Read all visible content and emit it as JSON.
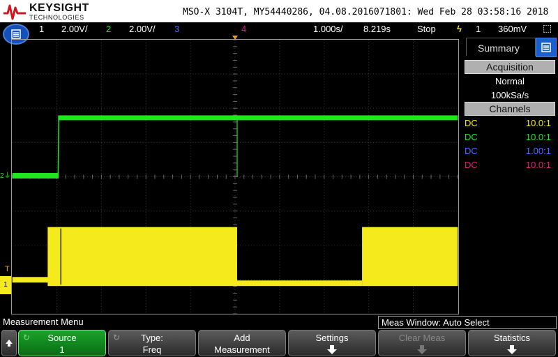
{
  "header": {
    "brand": "KEYSIGHT",
    "brand_sub": "TECHNOLOGIES",
    "model_line": "MSO-X 3104T, MY54440286, 04.08.2016071801: Wed Feb 28 03:58:16 2018"
  },
  "status": {
    "ch1_num": "1",
    "ch1_scale": "2.00V/",
    "ch2_num": "2",
    "ch2_scale": "2.00V/",
    "ch3_num": "3",
    "ch4_num": "4",
    "timebase": "1.000s/",
    "delay": "8.219s",
    "run_state": "Stop",
    "trigger_source": "1",
    "trigger_level": "360mV"
  },
  "side_panel": {
    "tab_label": "Summary",
    "acquisition_header": "Acquisition",
    "acq_mode": "Normal",
    "sample_rate": "100kSa/s",
    "channels_header": "Channels",
    "channels": [
      {
        "coupling": "DC",
        "probe": "10.0:1",
        "color": "#f4ea1c"
      },
      {
        "coupling": "DC",
        "probe": "10.0:1",
        "color": "#20e620"
      },
      {
        "coupling": "DC",
        "probe": "1.00:1",
        "color": "#4a6cff"
      },
      {
        "coupling": "DC",
        "probe": "10.0:1",
        "color": "#e0207a"
      }
    ]
  },
  "waveform_markers": {
    "ch1_label": "1",
    "ch2_label": "2",
    "trigger_label": "T"
  },
  "bottom": {
    "menu_title": "Measurement Menu",
    "meas_window": "Meas Window: Auto Select",
    "softkeys": [
      {
        "line1": "Source",
        "line2": "1",
        "state": "active"
      },
      {
        "line1": "Type:",
        "line2": "Freq",
        "state": "normal"
      },
      {
        "line1": "Add",
        "line2": "Measurement",
        "state": "normal"
      },
      {
        "line1": "Settings",
        "line2": "",
        "state": "normal"
      },
      {
        "line1": "Clear Meas",
        "line2": "",
        "state": "disabled"
      },
      {
        "line1": "Statistics",
        "line2": "",
        "state": "normal"
      }
    ]
  },
  "colors": {
    "ch1": "#f4ea1c",
    "ch2": "#20e620",
    "ch3": "#4a6cff",
    "ch4": "#e0207a",
    "trigger": "#f39a1a",
    "accent_blue": "#1a5fd0"
  }
}
